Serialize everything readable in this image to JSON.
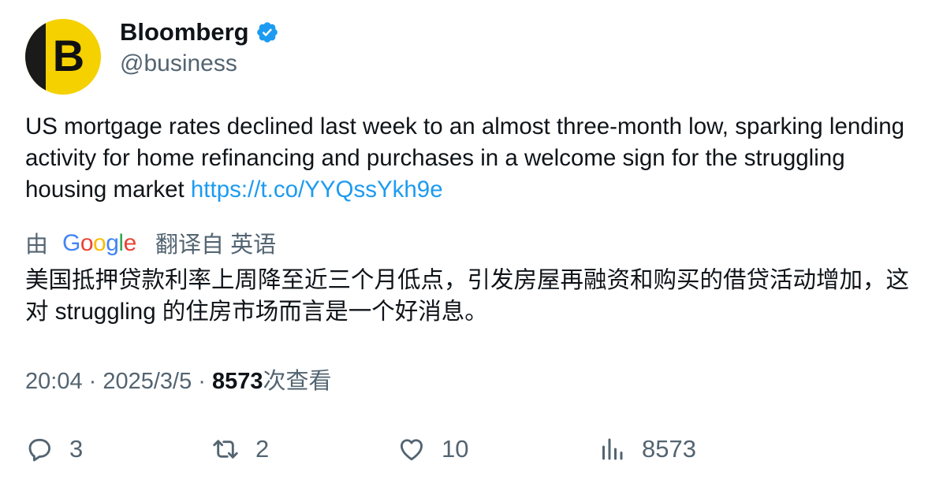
{
  "account": {
    "name": "Bloomberg",
    "handle": "@business",
    "avatar_letter": "B",
    "verified_icon": "verified-badge-icon",
    "brand_colors": {
      "avatar_bg": "#f5d100",
      "avatar_dark": "#1a1a1a",
      "verified": "#1d9bf0"
    }
  },
  "tweet": {
    "text": "US mortgage rates declined last week to an almost three-month low, sparking lending activity for home refinancing and purchases in a welcome sign for the struggling housing market ",
    "link": "https://t.co/YYQssYkh9e",
    "link_color": "#1d9bf0"
  },
  "translation": {
    "prefix": "由",
    "provider_logo": "Google",
    "label": "翻译自 英语",
    "text": "美国抵押贷款利率上周降至近三个月低点，引发房屋再融资和购买的借贷活动增加，这对 struggling 的住房市场而言是一个好消息。"
  },
  "meta": {
    "time": "20:04",
    "sep1": " · ",
    "date": "2025/3/5",
    "sep2": " · ",
    "views": "8573",
    "views_suffix": "次查看"
  },
  "actions": {
    "replies": "3",
    "retweets": "2",
    "likes": "10",
    "views": "8573",
    "icons": [
      "reply-icon",
      "retweet-icon",
      "like-icon",
      "views-icon"
    ]
  },
  "colors": {
    "text": "#0f1419",
    "secondary": "#536471"
  }
}
